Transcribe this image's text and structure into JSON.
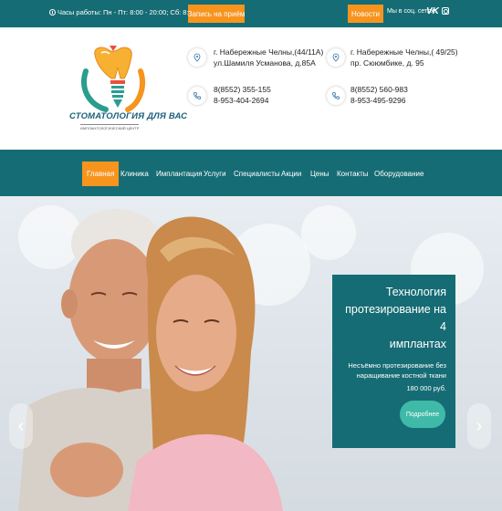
{
  "topbar": {
    "hours": "Часы работы: Пн - Пт: 8:00 - 20:00; Сб: 8:00 - 15:00",
    "appointment_label": "Запись на приём",
    "news_label": "Новости",
    "social_label": "Мы в соц. сетях:"
  },
  "logo": {
    "title": "СТОМАТОЛОГИЯ ДЛЯ ВАС",
    "subtitle": "ИМПЛАНТОЛОГИЧЕСКИЙ ЦЕНТР"
  },
  "contacts": {
    "address1_line1": "г. Набережные Челны,(44/11А)",
    "address1_line2": "ул.Шамиля Усманова, д.85А",
    "address2_line1": "г. Набережные Челны,( 49/25)",
    "address2_line2": "пр. Сююмбике, д. 95",
    "phone1_line1": "8(8552) 355-155",
    "phone1_line2": "8-953-404-2694",
    "phone2_line1": "8(8552) 560-983",
    "phone2_line2": "8-953-495-9296"
  },
  "nav": {
    "items": [
      "Главная",
      "Клиника",
      "Имплантация",
      "Услуги",
      "Специалисты",
      "Акции",
      "Цены",
      "Контакты",
      "Оборудование"
    ]
  },
  "slide": {
    "title_line1": "Технология",
    "title_line2": "протезирование на 4",
    "title_line3": "имплантах",
    "desc_line1": "Несъёмно протезирование без",
    "desc_line2": "наращивание костной ткани",
    "price": "180 000 руб.",
    "more_label": "Подробнее"
  },
  "colors": {
    "teal": "#166c74",
    "orange": "#f7941e",
    "button_teal": "#3fbaa8"
  }
}
